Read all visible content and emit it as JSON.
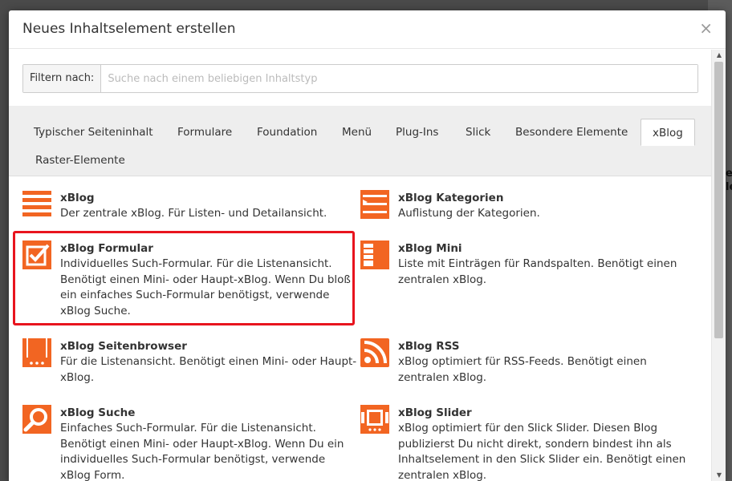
{
  "dialog": {
    "title": "Neues Inhaltselement erstellen",
    "close_glyph": "×"
  },
  "filter": {
    "label": "Filtern nach:",
    "placeholder": "Suche nach einem beliebigen Inhaltstyp",
    "value": ""
  },
  "tabs": [
    {
      "label": "Typischer Seiteninhalt",
      "active": false
    },
    {
      "label": "Formulare",
      "active": false
    },
    {
      "label": "Foundation",
      "active": false
    },
    {
      "label": "Menü",
      "active": false
    },
    {
      "label": "Plug-Ins",
      "active": false
    },
    {
      "label": "Slick",
      "active": false
    },
    {
      "label": "Besondere Elemente",
      "active": false
    },
    {
      "label": "xBlog",
      "active": true
    },
    {
      "label": "Raster-Elemente",
      "active": false
    }
  ],
  "items": [
    {
      "title": "xBlog",
      "desc": "Der zentrale xBlog. Für Listen- und Detailansicht.",
      "icon": "list-lines-icon"
    },
    {
      "title": "xBlog Kategorien",
      "desc": "Auflistung der Kategorien.",
      "icon": "category-list-icon"
    },
    {
      "title": "xBlog Formular",
      "desc": "Individuelles Such-Formular. Für die Listenansicht. Benötigt einen Mini- oder Haupt-xBlog. Wenn Du bloß ein einfaches Such-Formular benötigst, verwende xBlog Suche.",
      "icon": "checkbox-edit-icon"
    },
    {
      "title": "xBlog Mini",
      "desc": "Liste mit Einträgen für Randspalten. Benötigt einen zentralen xBlog.",
      "icon": "mini-list-icon"
    },
    {
      "title": "xBlog Seitenbrowser",
      "desc": "Für die Listenansicht. Benötigt einen Mini- oder Haupt-xBlog.",
      "icon": "page-browser-icon"
    },
    {
      "title": "xBlog RSS",
      "desc": "xBlog optimiert für RSS-Feeds. Benötigt einen zentralen xBlog.",
      "icon": "rss-icon"
    },
    {
      "title": "xBlog Suche",
      "desc": "Einfaches Such-Formular. Für die Listenansicht. Benötigt einen Mini- oder Haupt-xBlog. Wenn Du ein individuelles Such-Formular benötigst, verwende xBlog Form.",
      "icon": "search-icon"
    },
    {
      "title": "xBlog Slider",
      "desc": "xBlog optimiert für den Slick Slider. Diesen Blog publizierst Du nicht direkt, sondern bindest ihn als Inhaltselement in den Slick Slider ein. Benötigt einen zentralen xBlog.",
      "icon": "slider-icon"
    }
  ],
  "background_text": "e\nle",
  "accent_color": "#f26522",
  "highlight_color": "#e8141e"
}
